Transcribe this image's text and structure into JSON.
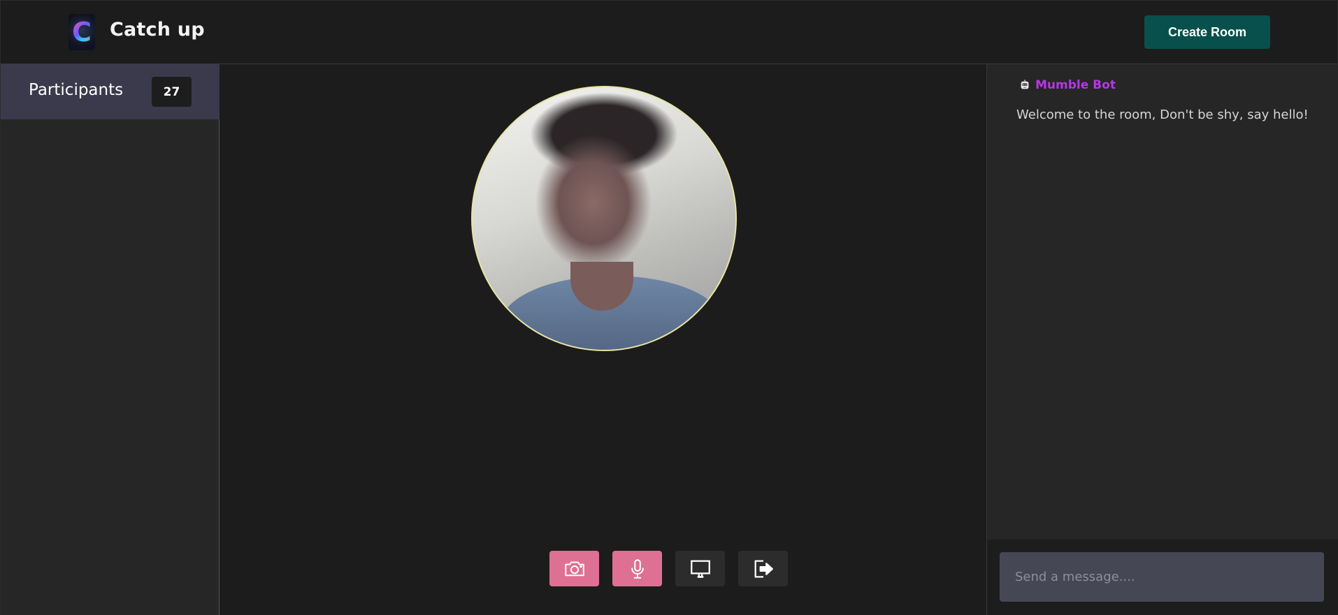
{
  "header": {
    "logo_icon": "catch-up-logo-icon",
    "logo_letter": "C",
    "title": "Catch up",
    "create_room_label": "Create Room"
  },
  "participants": {
    "label": "Participants",
    "count": "27"
  },
  "controls": [
    {
      "icon": "camera-icon",
      "color": "#de7094",
      "state": "active"
    },
    {
      "icon": "microphone-icon",
      "color": "#de7094",
      "state": "active"
    },
    {
      "icon": "screen-share-icon",
      "color": "#2c2c2c",
      "state": "inactive"
    },
    {
      "icon": "leave-room-icon",
      "color": "#2c2c2c",
      "state": "inactive"
    }
  ],
  "chat": {
    "messages": [
      {
        "author": "Mumble Bot",
        "author_icon": "bot-icon",
        "text": "Welcome to the room, Don't be shy, say hello!"
      }
    ],
    "input_placeholder": "Send a message...."
  },
  "colors": {
    "accent_teal": "#08504c",
    "accent_pink": "#de7094",
    "bot_purple": "#b637e6",
    "participants_header": "#3b3a4c",
    "video_border": "#e8e4a6"
  }
}
